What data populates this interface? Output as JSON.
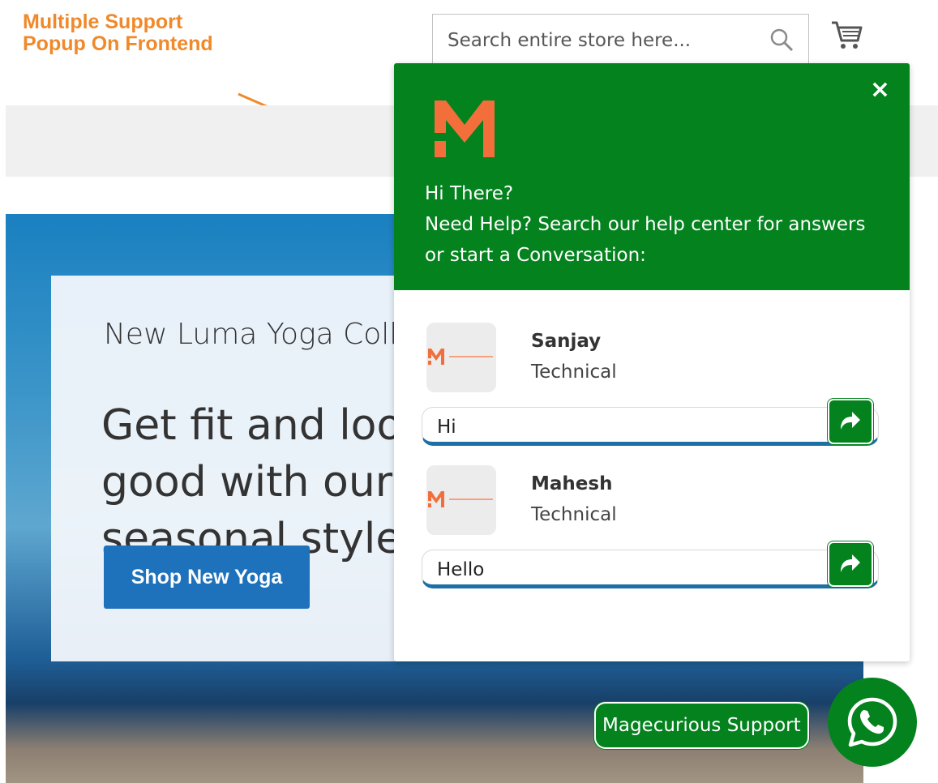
{
  "annotation": {
    "line1": "Multiple Support",
    "line2": "Popup On Frontend"
  },
  "header": {
    "search_placeholder": "Search entire store here..."
  },
  "hero": {
    "subtitle": "New Luma Yoga Collection",
    "title": "Get fit and look good with our seasonal styles",
    "button_label": "Shop New Yoga"
  },
  "popup": {
    "close_label": "×",
    "greeting_line1": "Hi There?",
    "greeting_line2": "Need Help? Search our help center for answers",
    "greeting_line3": "or start a Conversation:",
    "agents": [
      {
        "name": "Sanjay",
        "role": "Technical",
        "message": "Hi"
      },
      {
        "name": "Mahesh",
        "role": "Technical",
        "message": "Hello"
      }
    ]
  },
  "launcher": {
    "label": "Magecurious Support"
  },
  "colors": {
    "brand_green": "#04821e",
    "annotation_orange": "#f0892a",
    "logo_orange": "#f26f3c",
    "button_blue": "#1e72bb"
  },
  "icons": [
    "search-icon",
    "cart-icon",
    "close-icon",
    "brand-logo-icon",
    "share-arrow-icon",
    "whatsapp-icon"
  ]
}
